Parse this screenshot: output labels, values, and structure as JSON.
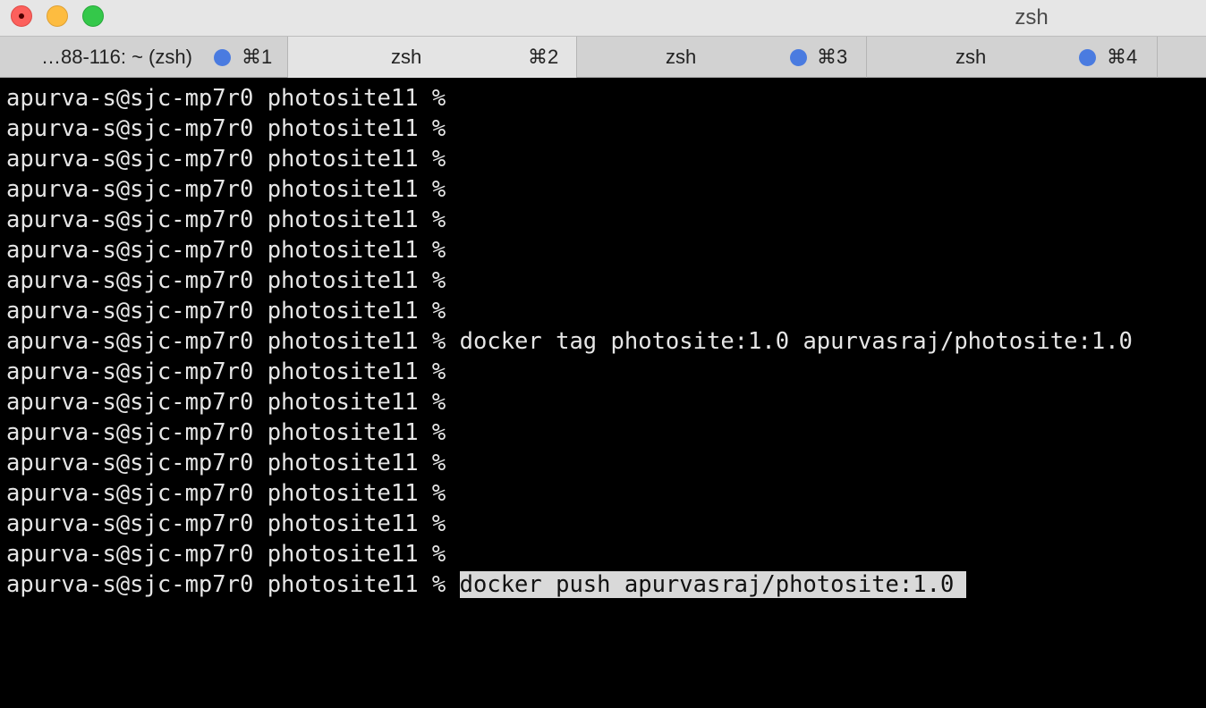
{
  "window": {
    "title": "zsh",
    "controls": {
      "close_color": "#fc605c",
      "minimize_color": "#fdbc40",
      "maximize_color": "#34c84a"
    }
  },
  "tabs": [
    {
      "label": "…88-116: ~ (zsh)",
      "shortcut": "⌘1",
      "has_activity_dot": true,
      "active": false
    },
    {
      "label": "zsh",
      "shortcut": "⌘2",
      "has_activity_dot": false,
      "active": true
    },
    {
      "label": "zsh",
      "shortcut": "⌘3",
      "has_activity_dot": true,
      "active": false
    },
    {
      "label": "zsh",
      "shortcut": "⌘4",
      "has_activity_dot": true,
      "active": false
    }
  ],
  "terminal": {
    "prompt": "apurva-s@sjc-mp7r0 photosite11 % ",
    "lines": [
      {
        "command": ""
      },
      {
        "command": ""
      },
      {
        "command": ""
      },
      {
        "command": ""
      },
      {
        "command": ""
      },
      {
        "command": ""
      },
      {
        "command": ""
      },
      {
        "command": ""
      },
      {
        "command": "docker tag photosite:1.0 apurvasraj/photosite:1.0"
      },
      {
        "command": ""
      },
      {
        "command": ""
      },
      {
        "command": ""
      },
      {
        "command": ""
      },
      {
        "command": ""
      },
      {
        "command": ""
      },
      {
        "command": ""
      },
      {
        "command": "docker push apurvasraj/photosite:1.0",
        "selected": true
      }
    ],
    "colors": {
      "background": "#000000",
      "foreground": "#e6e6e6",
      "selection": "#d9d9d9"
    }
  }
}
